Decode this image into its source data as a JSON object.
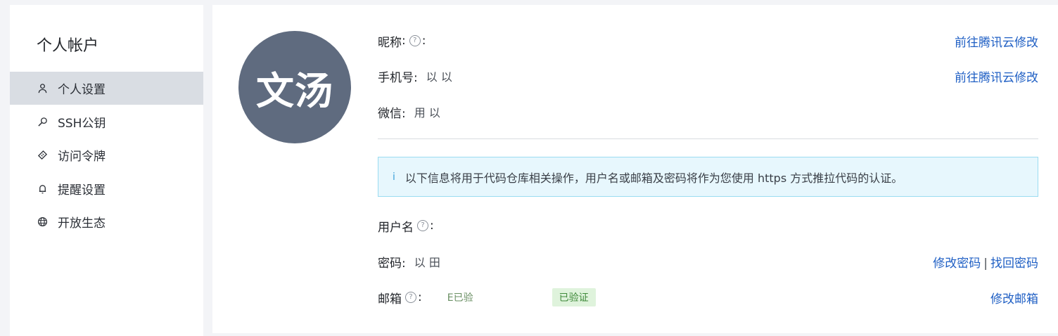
{
  "sidebar": {
    "title": "个人帐户",
    "items": [
      {
        "label": "个人设置",
        "icon": "user-icon",
        "active": true
      },
      {
        "label": "SSH公钥",
        "icon": "key-icon",
        "active": false
      },
      {
        "label": "访问令牌",
        "icon": "ticket-icon",
        "active": false
      },
      {
        "label": "提醒设置",
        "icon": "bell-icon",
        "active": false
      },
      {
        "label": "开放生态",
        "icon": "globe-icon",
        "active": false
      }
    ]
  },
  "profile": {
    "avatar_text": "文汤",
    "nickname_label": "昵称",
    "phone_label": "手机号:",
    "phone_value": "以          以",
    "phone_action": "前往腾讯云修改",
    "nickname_action": "前往腾讯云修改",
    "wechat_label": "微信:",
    "wechat_value": "用 以",
    "notice": "以下信息将用于代码仓库相关操作，用户名或邮箱及密码将作为您使用 https 方式推拉代码的认证。",
    "username_label": "用户名",
    "password_label": "密码:",
    "password_value": "以 田",
    "password_change": "修改密码",
    "password_sep": "|",
    "password_recover": "找回密码",
    "email_label": "邮箱",
    "email_value_inline": "E已验",
    "email_badge": "已验证",
    "email_action": "修改邮箱"
  },
  "colors": {
    "link": "#1f5fc4",
    "avatar_bg": "#5f6b7f",
    "notice_bg": "#e7f7fd",
    "badge_bg": "#dff3dc"
  }
}
